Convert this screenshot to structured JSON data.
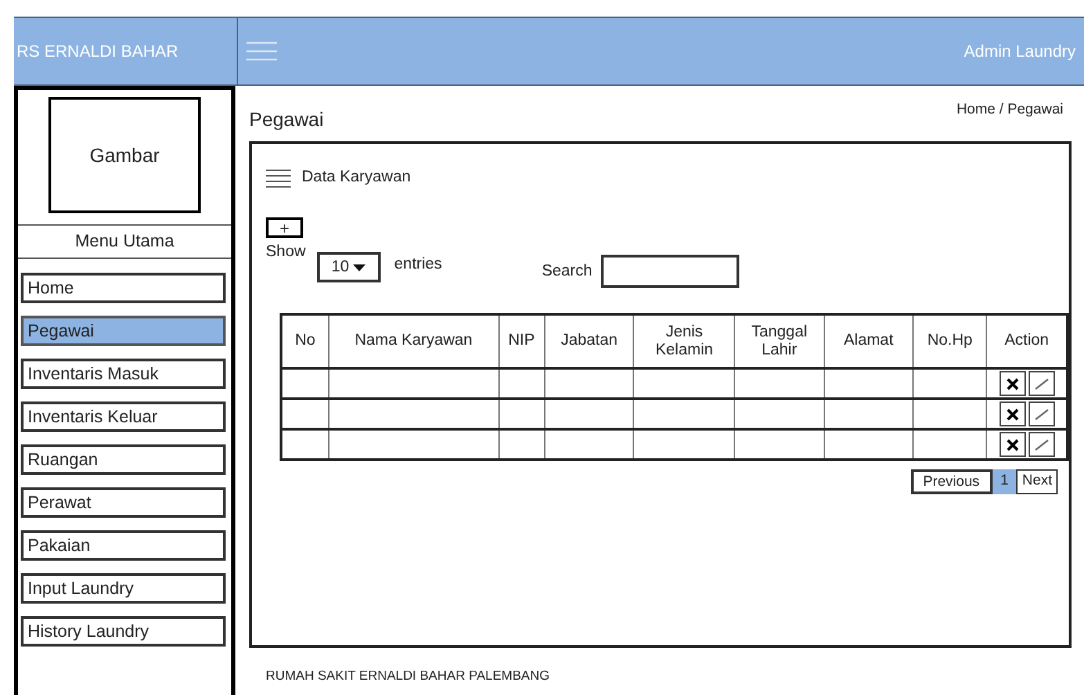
{
  "header": {
    "brand": "RS ERNALDI BAHAR",
    "user": "Admin Laundry"
  },
  "sidebar": {
    "image_label": "Gambar",
    "menu_title": "Menu Utama",
    "items": [
      {
        "label": "Home",
        "selected": false
      },
      {
        "label": "Pegawai",
        "selected": true
      },
      {
        "label": "Inventaris Masuk",
        "selected": false
      },
      {
        "label": "Inventaris Keluar",
        "selected": false
      },
      {
        "label": "Ruangan",
        "selected": false
      },
      {
        "label": "Perawat",
        "selected": false
      },
      {
        "label": "Pakaian",
        "selected": false
      },
      {
        "label": "Input Laundry",
        "selected": false
      },
      {
        "label": "History Laundry",
        "selected": false
      }
    ]
  },
  "page": {
    "title": "Pegawai",
    "breadcrumb": "Home / Pegawai"
  },
  "panel": {
    "title": "Data Karyawan",
    "add_button": "+",
    "show_label": "Show",
    "entries_value": "10",
    "entries_label": "entries",
    "search_label": "Search"
  },
  "table": {
    "columns": [
      "No",
      "Nama Karyawan",
      "NIP",
      "Jabatan",
      "Jenis Kelamin",
      "Tanggal Lahir",
      "Alamat",
      "No.Hp",
      "Action"
    ],
    "rows": [
      {
        "kind": "empty"
      },
      {
        "kind": "empty"
      },
      {
        "kind": "empty"
      }
    ]
  },
  "pagination": [
    {
      "label": "Previous",
      "selected": false
    },
    {
      "label": "1",
      "selected": true
    },
    {
      "label": "Next",
      "selected": false
    }
  ],
  "footer": "RUMAH SAKIT ERNALDI BAHAR PALEMBANG"
}
